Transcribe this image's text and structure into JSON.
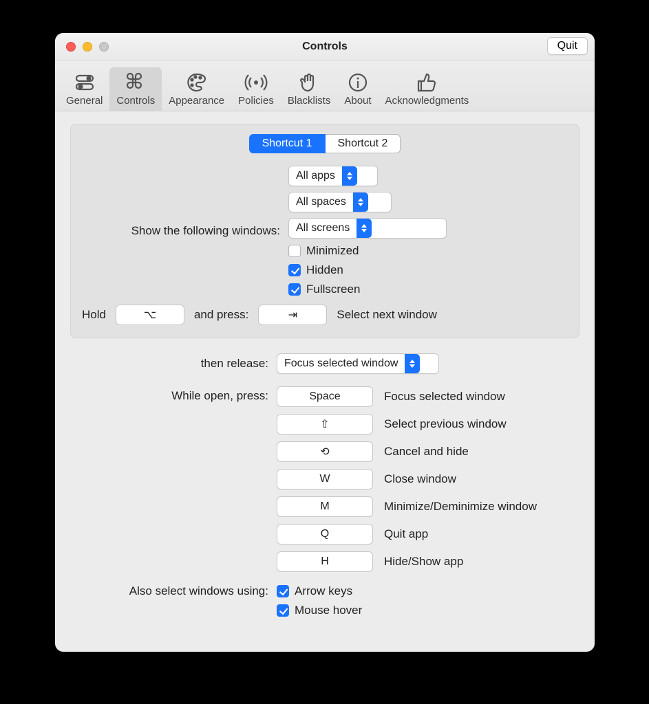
{
  "window": {
    "title": "Controls",
    "quit": "Quit"
  },
  "toolbar": [
    {
      "id": "general",
      "label": "General"
    },
    {
      "id": "controls",
      "label": "Controls"
    },
    {
      "id": "appearance",
      "label": "Appearance"
    },
    {
      "id": "policies",
      "label": "Policies"
    },
    {
      "id": "blacklists",
      "label": "Blacklists"
    },
    {
      "id": "about",
      "label": "About"
    },
    {
      "id": "ack",
      "label": "Acknowledgments"
    }
  ],
  "tabs": {
    "s1": "Shortcut 1",
    "s2": "Shortcut 2"
  },
  "group": {
    "show_label": "Show the following windows:",
    "apps": "All apps",
    "spaces": "All spaces",
    "screens": "All screens",
    "minimized": "Minimized",
    "hidden": "Hidden",
    "fullscreen": "Fullscreen",
    "hold": "Hold",
    "hold_key": "⌥",
    "and_press": "and press:",
    "press_key": "⇥",
    "next": "Select next window"
  },
  "release": {
    "label": "then release:",
    "value": "Focus selected window"
  },
  "while_open": {
    "label": "While open, press:",
    "rows": [
      {
        "key": "Space",
        "desc": "Focus selected window"
      },
      {
        "key": "⇧",
        "desc": "Select previous window"
      },
      {
        "key": "⟲",
        "desc": "Cancel and hide"
      },
      {
        "key": "W",
        "desc": "Close window"
      },
      {
        "key": "M",
        "desc": "Minimize/Deminimize window"
      },
      {
        "key": "Q",
        "desc": "Quit app"
      },
      {
        "key": "H",
        "desc": "Hide/Show app"
      }
    ]
  },
  "also": {
    "label": "Also select windows using:",
    "arrow": "Arrow keys",
    "mouse": "Mouse hover"
  }
}
